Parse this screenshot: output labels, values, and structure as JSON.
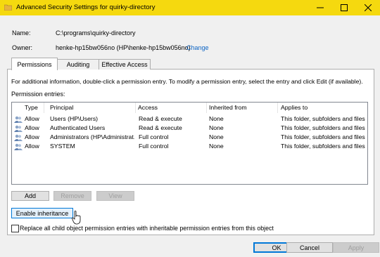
{
  "window": {
    "title": "Advanced Security Settings for quirky-directory",
    "title_bar_color": "#f5d90f",
    "icon": "folder-icon",
    "controls": [
      "minimize-icon",
      "maximize-icon",
      "close-icon"
    ]
  },
  "info": {
    "name_label": "Name:",
    "name_value": "C:\\programs\\quirky-directory",
    "owner_label": "Owner:",
    "owner_value": "henke-hp15bw056no (HP\\henke-hp15bw056no)",
    "change_link": "Change"
  },
  "tabs": [
    {
      "label": "Permissions",
      "active": true
    },
    {
      "label": "Auditing",
      "active": false
    },
    {
      "label": "Effective Access",
      "active": false
    }
  ],
  "instructions": "For additional information, double-click a permission entry. To modify a permission entry, select the entry and click Edit (if available).",
  "permission_entries_label": "Permission entries:",
  "table": {
    "columns": [
      "Type",
      "Principal",
      "Access",
      "Inherited from",
      "Applies to"
    ],
    "rows": [
      {
        "type": "Allow",
        "principal": "Users (HP\\Users)",
        "access": "Read & execute",
        "inherited": "None",
        "applies": "This folder, subfolders and files"
      },
      {
        "type": "Allow",
        "principal": "Authenticated Users",
        "access": "Read & execute",
        "inherited": "None",
        "applies": "This folder, subfolders and files"
      },
      {
        "type": "Allow",
        "principal": "Administrators (HP\\Administrat...",
        "access": "Full control",
        "inherited": "None",
        "applies": "This folder, subfolders and files"
      },
      {
        "type": "Allow",
        "principal": "SYSTEM",
        "access": "Full control",
        "inherited": "None",
        "applies": "This folder, subfolders and files"
      }
    ]
  },
  "buttons": {
    "add": "Add",
    "remove": "Remove",
    "view": "View",
    "enable_inheritance": "Enable inheritance"
  },
  "replace_checkbox": {
    "label": "Replace all child object permission entries with inheritable permission entries from this object",
    "checked": false
  },
  "footer": {
    "ok": "OK",
    "cancel": "Cancel",
    "apply": "Apply"
  }
}
